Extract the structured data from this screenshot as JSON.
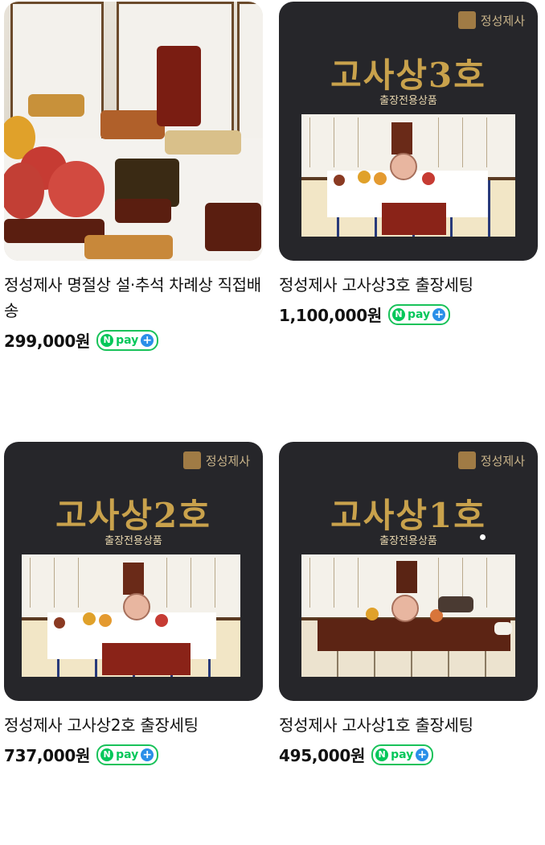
{
  "products": [
    {
      "title": "정성제사 명절상 설·추석 차례상 직접배송",
      "price": "299,000원"
    },
    {
      "title": "정성제사 고사상3호 출장세팅",
      "price": "1,100,000원",
      "banner": {
        "brand": "정성제사",
        "headline": "고사상3호",
        "subline": "출장전용상품"
      }
    },
    {
      "title": "정성제사 고사상2호 출장세팅",
      "price": "737,000원",
      "banner": {
        "brand": "정성제사",
        "headline": "고사상2호",
        "subline": "출장전용상품"
      }
    },
    {
      "title": "정성제사 고사상1호 출장세팅",
      "price": "495,000원",
      "banner": {
        "brand": "정성제사",
        "headline": "고사상1호",
        "subline": "출장전용상품"
      }
    }
  ],
  "npay": {
    "n": "N",
    "label": "pay",
    "plus": "+"
  },
  "colors": {
    "npay_green": "#03c75a",
    "npay_plus": "#2a8fe8",
    "banner_bg": "#26262a",
    "gold": "#c9a24c"
  }
}
